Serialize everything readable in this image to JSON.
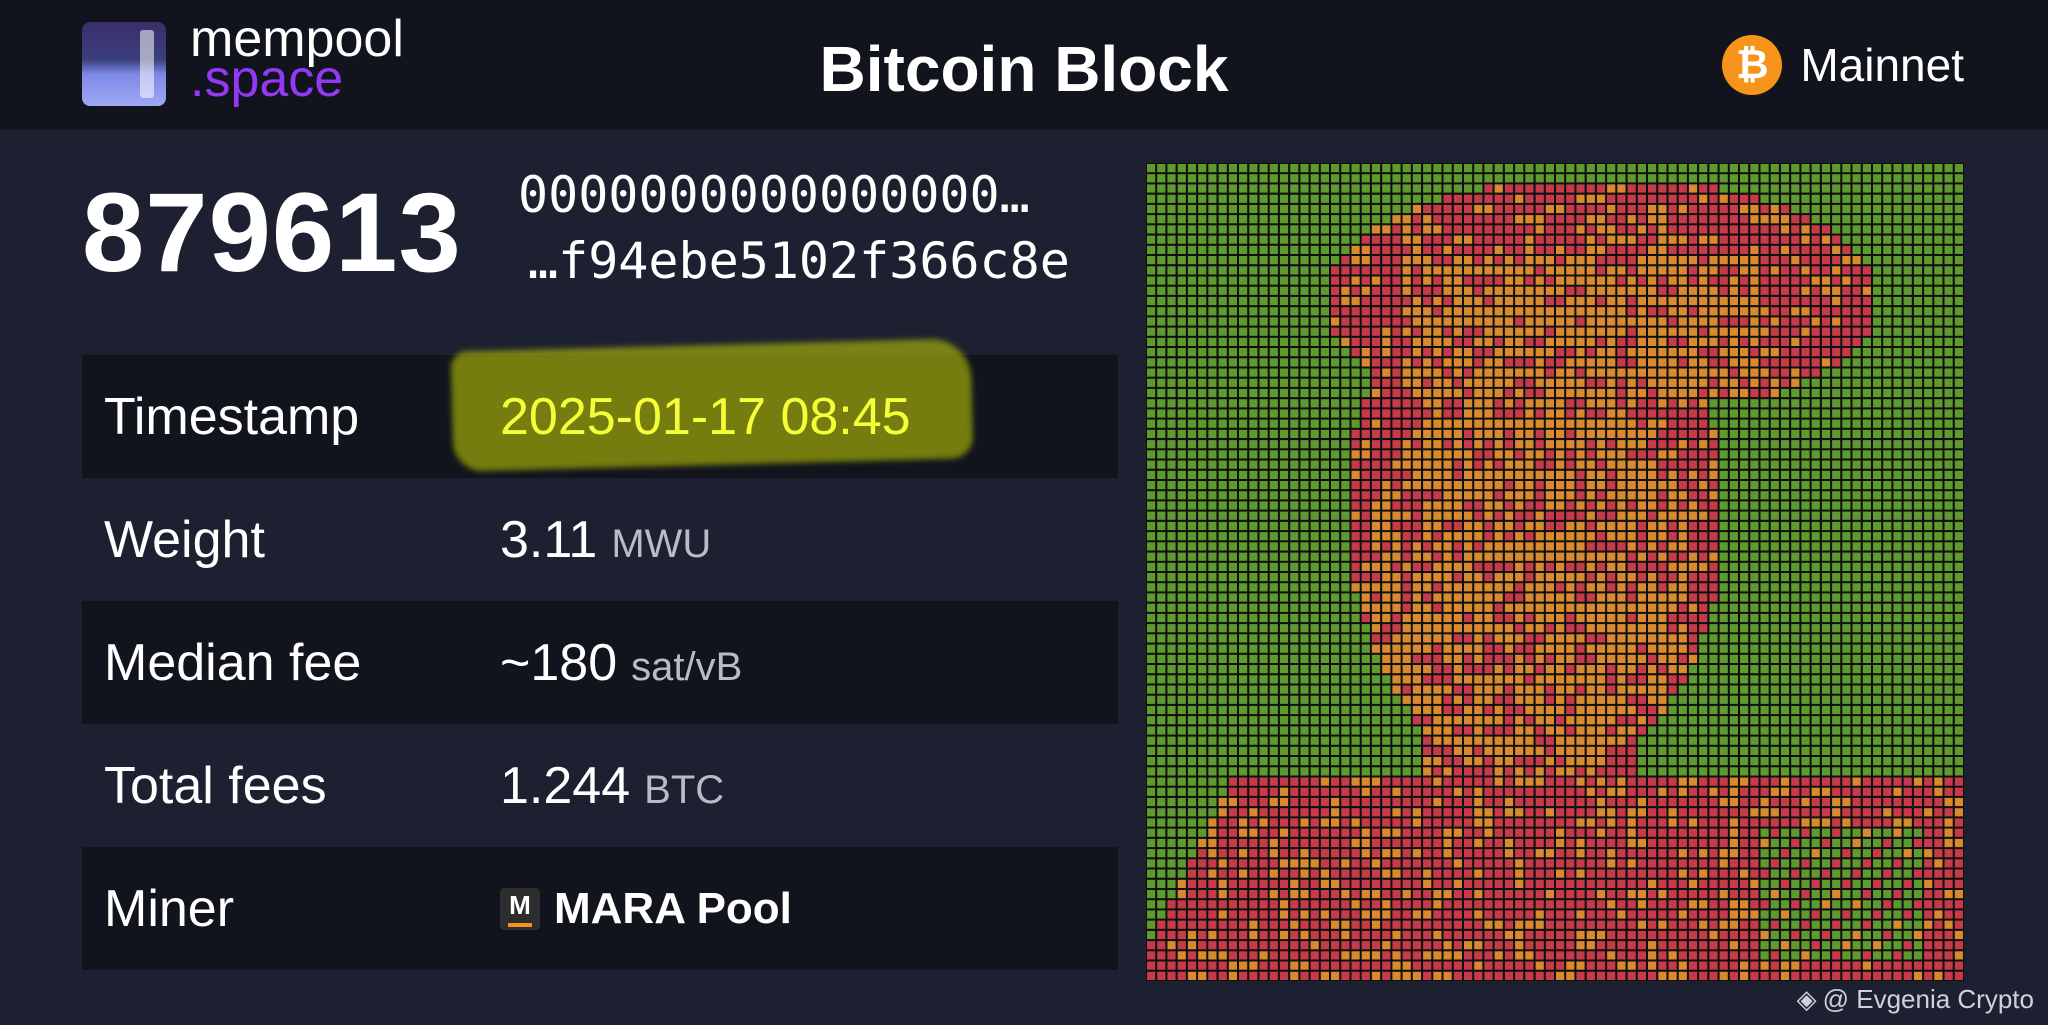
{
  "header": {
    "logo_line1": "mempool",
    "logo_line2": ".space",
    "title": "Bitcoin Block",
    "network_label": "Mainnet",
    "network_icon": "bitcoin-icon"
  },
  "block": {
    "height": "879613",
    "hash_line1": "0000000000000000…",
    "hash_line2": "…f94ebe5102f366c8e"
  },
  "details": [
    {
      "label": "Timestamp",
      "value": "2025-01-17 08:45",
      "unit": "",
      "highlighted": true
    },
    {
      "label": "Weight",
      "value": "3.11",
      "unit": "MWU"
    },
    {
      "label": "Median fee",
      "value": "~180",
      "unit": "sat/vB"
    },
    {
      "label": "Total fees",
      "value": "1.244",
      "unit": "BTC"
    },
    {
      "label": "Miner",
      "value": "MARA Pool",
      "unit": "",
      "icon": "mara-pool-icon"
    }
  ],
  "visualization": {
    "colors": {
      "green": "#5f9a2f",
      "red": "#c73a4a",
      "orange": "#d98a2e"
    }
  },
  "credit": {
    "text": "@ Evgenia Crypto",
    "icon": "binance-icon"
  },
  "colors": {
    "header_bg": "#11131d",
    "page_bg": "#1d2030",
    "brand_purple": "#9339f4",
    "bitcoin_orange": "#f7931a",
    "highlight_yellow": "#f4ff3a"
  }
}
